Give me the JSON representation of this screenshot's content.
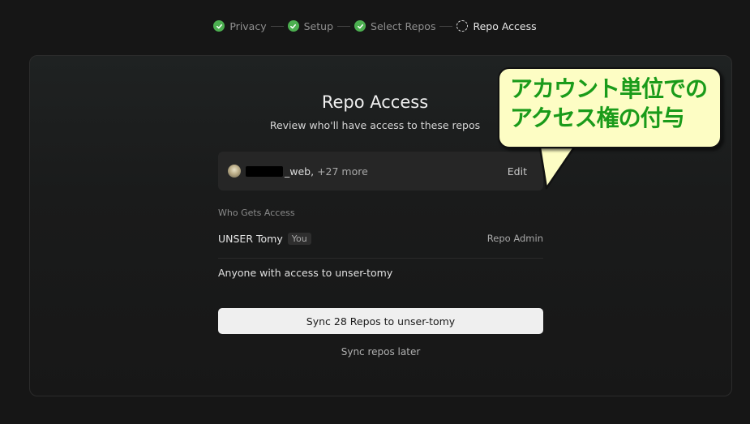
{
  "stepper": {
    "steps": [
      {
        "label": "Privacy",
        "status": "done"
      },
      {
        "label": "Setup",
        "status": "done"
      },
      {
        "label": "Select Repos",
        "status": "done"
      },
      {
        "label": "Repo Access",
        "status": "current"
      }
    ]
  },
  "card": {
    "title": "Repo Access",
    "subtitle": "Review who'll have access to these repos",
    "repos": {
      "name_suffix": "_web,",
      "more": "+27 more",
      "edit_label": "Edit"
    },
    "who_gets_access_label": "Who Gets Access",
    "member": {
      "name": "UNSER Tomy",
      "badge": "You",
      "role": "Repo Admin"
    },
    "anyone_text": "Anyone with access to unser-tomy",
    "sync_button_label": "Sync 28 Repos to unser-tomy",
    "later_label": "Sync repos later"
  },
  "callout": {
    "line1": "アカウント単位での",
    "line2": "アクセス権の付与"
  },
  "colors": {
    "background": "#161616",
    "step_done": "#4caf50",
    "callout_fill": "#fdfdc4",
    "callout_text": "#1a9b1a"
  }
}
